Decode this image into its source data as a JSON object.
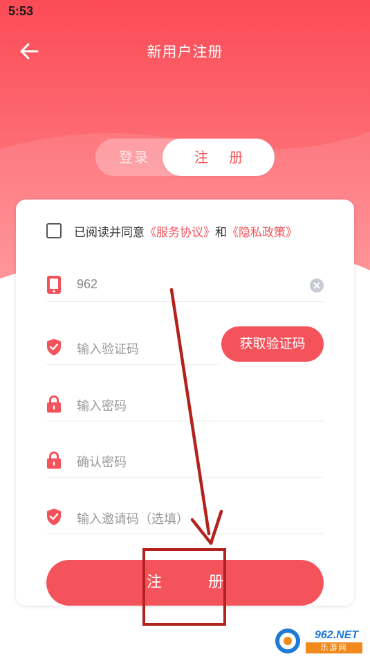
{
  "status_bar": {
    "time": "5:53"
  },
  "header": {
    "title": "新用户注册",
    "back_icon": "arrow-left-icon"
  },
  "tabs": [
    {
      "label": "登录",
      "active": false
    },
    {
      "label": "注 册",
      "active": true
    }
  ],
  "agreement": {
    "checked": false,
    "prefix": "已阅读并同意",
    "service_link": "《服务协议》",
    "and": "和",
    "privacy_link": "《隐私政策》"
  },
  "form": {
    "phone": {
      "value": "962",
      "icon": "phone-icon",
      "clear_icon": "clear-icon"
    },
    "code": {
      "placeholder": "输入验证码",
      "icon": "shield-icon",
      "button": "获取验证码"
    },
    "password": {
      "placeholder": "输入密码",
      "icon": "lock-icon"
    },
    "confirm": {
      "placeholder": "确认密码",
      "icon": "lock-icon"
    },
    "invite": {
      "placeholder": "输入邀请码（选填）",
      "icon": "shield-icon"
    }
  },
  "submit": {
    "label": "注 册"
  },
  "watermark": {
    "site": "962.NET",
    "sub": "乐游网"
  },
  "colors": {
    "accent": "#f5535c",
    "header_gradient_top": "#fb4b56",
    "header_gradient_bottom": "#ff8a8e",
    "annotation": "#b3221c"
  }
}
